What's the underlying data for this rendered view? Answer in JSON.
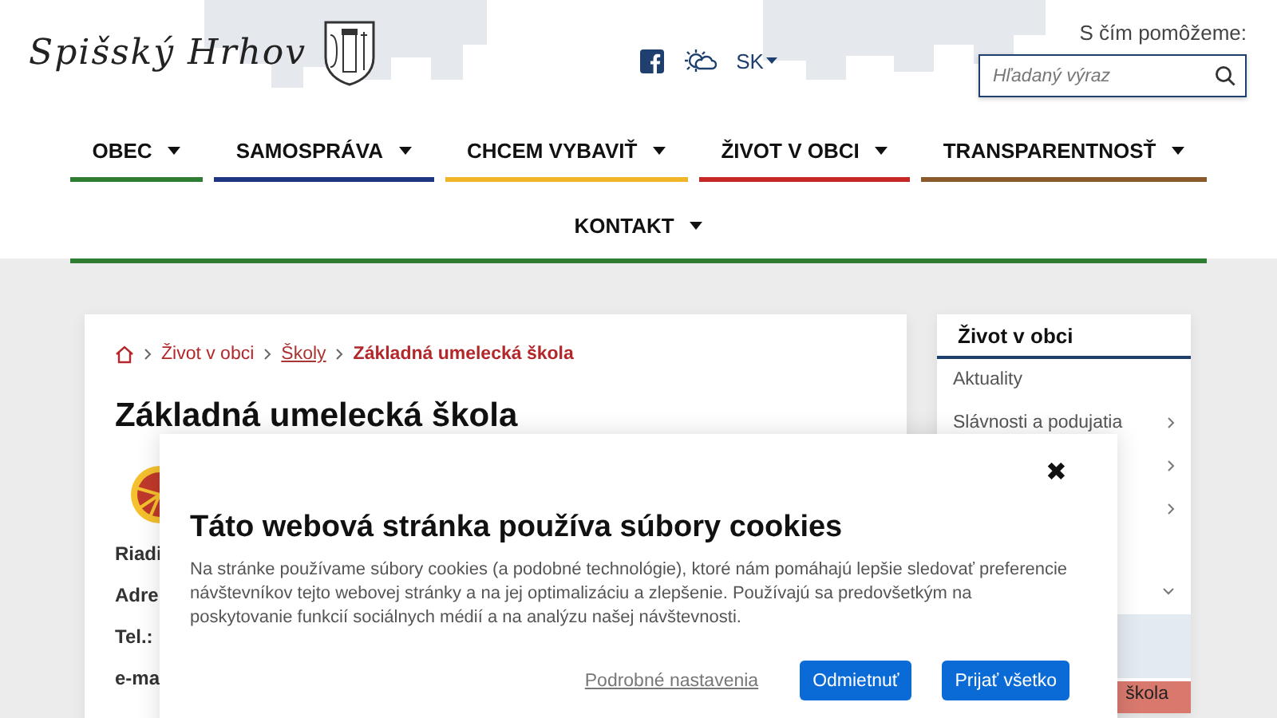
{
  "header": {
    "logo_text": "Spišský Hrhov",
    "language": "SK",
    "help_label": "S čím pomôžeme:",
    "search": {
      "placeholder": "Hľadaný výraz"
    }
  },
  "nav": [
    {
      "label": "OBEC",
      "color": "#2e7d32"
    },
    {
      "label": "SAMOSPRÁVA",
      "color": "#1f3580"
    },
    {
      "label": "CHCEM VYBAVIŤ",
      "color": "#f0b429"
    },
    {
      "label": "ŽIVOT V OBCI",
      "color": "#c62828"
    },
    {
      "label": "TRANSPARENTNOSŤ",
      "color": "#8b5a2b"
    },
    {
      "label": "KONTAKT",
      "color": "#2e7d32"
    }
  ],
  "breadcrumb": [
    {
      "kind": "home"
    },
    {
      "kind": "link",
      "label": "Život v obci"
    },
    {
      "kind": "underlined",
      "label": "Školy"
    },
    {
      "kind": "current",
      "label": "Základná umelecká škola"
    }
  ],
  "page": {
    "title": "Základná umelecká škola",
    "details": [
      "Riadi",
      "Adre",
      "Tel.:",
      "e-ma"
    ]
  },
  "sidebar": {
    "title": "Život v obci",
    "items": [
      {
        "kind": "link",
        "label": "Aktuality"
      },
      {
        "kind": "submenu",
        "label": "Slávnosti a podujatia",
        "expanded": false
      },
      {
        "kind": "submenu",
        "expanded": false
      },
      {
        "kind": "submenu",
        "expanded": false
      },
      {
        "kind": "submenu",
        "expanded": true,
        "children": [
          {
            "selected": false
          },
          {
            "label": "škola",
            "selected": true
          }
        ]
      }
    ]
  },
  "cookie_dialog": {
    "title": "Táto webová stránka používa súbory cookies",
    "text": "Na stránke používame súbory cookies (a podobné technológie), ktoré nám pomáhajú lepšie sledovať preferencie návštevníkov tejto webovej stránky a na jej optimalizáciu a zlepšenie. Používajú sa predovšetkým na poskytovanie funkcií sociálnych médií a na analýzu našej návštevnosti.",
    "close": "✖",
    "buttons": [
      {
        "kind": "link",
        "label": "Podrobné nastavenia"
      },
      {
        "kind": "primary",
        "label": "Odmietnuť"
      },
      {
        "kind": "primary",
        "label": "Prijať všetko"
      }
    ]
  }
}
